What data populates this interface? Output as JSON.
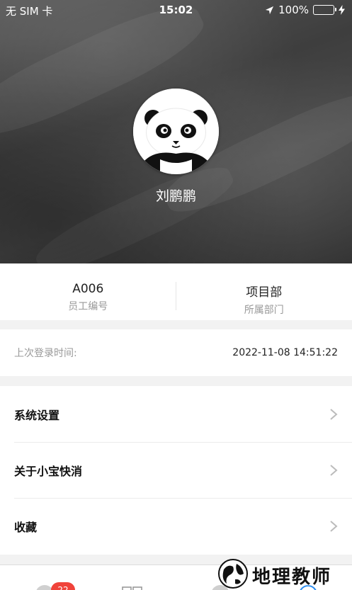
{
  "status_bar": {
    "carrier": "无 SIM 卡",
    "time": "15:02",
    "battery": "100%",
    "battery_color": "#4cd964"
  },
  "profile": {
    "name": "刘鹏鹏",
    "avatar_icon": "panda-avatar-icon"
  },
  "stats": [
    {
      "value": "A006",
      "label": "员工编号"
    },
    {
      "value": "项目部",
      "label": "所属部门"
    }
  ],
  "last_login": {
    "label": "上次登录时间:",
    "value": "2022-11-08 14:51:22"
  },
  "menu": {
    "items": [
      {
        "label": "系统设置",
        "icon": "chevron-right-icon"
      },
      {
        "label": "关于小宝快消",
        "icon": "chevron-right-icon"
      },
      {
        "label": "收藏",
        "icon": "chevron-right-icon"
      }
    ]
  },
  "tabbar": {
    "badge": "22",
    "badge_color": "#f0433a"
  },
  "watermark": {
    "text": "地理教师"
  }
}
